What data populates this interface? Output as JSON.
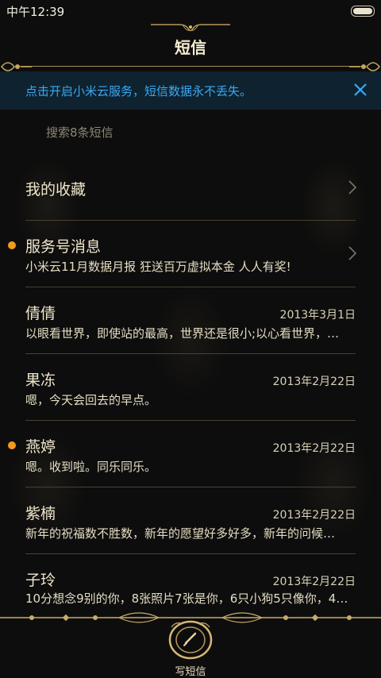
{
  "status_bar": {
    "time": "中午12:39"
  },
  "header": {
    "title": "短信"
  },
  "banner": {
    "text": "点击开启小米云服务，短信数据永不丢失。"
  },
  "search": {
    "placeholder": "搜索8条短信"
  },
  "favorites": {
    "label": "我的收藏"
  },
  "service": {
    "name": "服务号消息",
    "preview": "小米云11月数据月报 狂送百万虚拟本金 人人有奖!"
  },
  "conversations": [
    {
      "name": "倩倩",
      "date": "2013年3月1日",
      "preview": "以眼看世界，即使站的最高，世界还是很小;以心看世界，…",
      "unread": false
    },
    {
      "name": "果冻",
      "date": "2013年2月22日",
      "preview": "嗯，今天会回去的早点。",
      "unread": false
    },
    {
      "name": "燕婷",
      "date": "2013年2月22日",
      "preview": "嗯。收到啦。同乐同乐。",
      "unread": true
    },
    {
      "name": "紫楠",
      "date": "2013年2月22日",
      "preview": "新年的祝福数不胜数，新年的愿望好多好多，新年的问候…",
      "unread": false
    },
    {
      "name": "子玲",
      "date": "2013年2月22日",
      "preview": "10分想念9别的你，8张照片7张是你，6只小狗5只像你，4…",
      "unread": false
    }
  ],
  "bottom_bar": {
    "compose_label": "写短信"
  },
  "colors": {
    "accent_gold": "#a48a50",
    "unread_dot": "#f39b1c",
    "banner_text": "#3aa9f2",
    "background": "#0d0d0d"
  }
}
